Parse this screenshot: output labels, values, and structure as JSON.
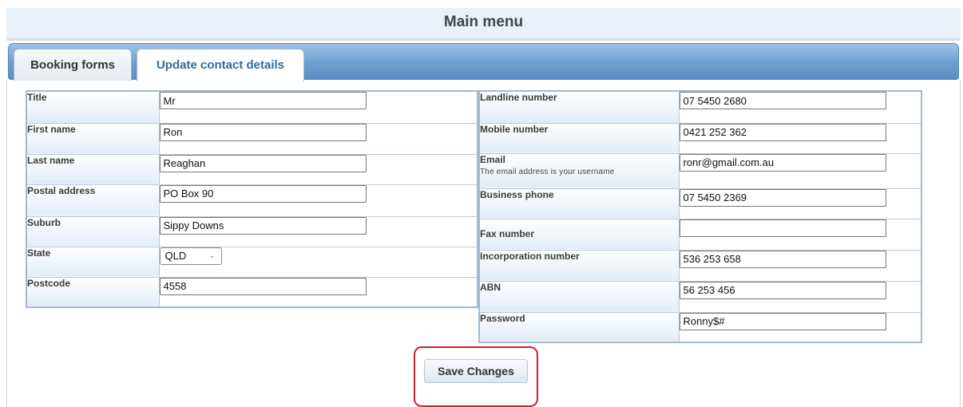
{
  "page": {
    "title": "Main menu"
  },
  "tabs": [
    {
      "label": "Booking forms",
      "active": false
    },
    {
      "label": "Update contact details",
      "active": true
    }
  ],
  "left_form": {
    "title": {
      "label": "Title",
      "value": "Mr"
    },
    "first_name": {
      "label": "First name",
      "value": "Ron"
    },
    "last_name": {
      "label": "Last name",
      "value": "Reaghan"
    },
    "postal_address": {
      "label": "Postal address",
      "value": "PO Box 90"
    },
    "suburb": {
      "label": "Suburb",
      "value": "Sippy Downs"
    },
    "state": {
      "label": "State",
      "value": "QLD"
    },
    "postcode": {
      "label": "Postcode",
      "value": "4558"
    }
  },
  "right_form": {
    "landline": {
      "label": "Landline number",
      "value": "07 5450 2680"
    },
    "mobile": {
      "label": "Mobile number",
      "value": "0421 252 362"
    },
    "email": {
      "label": "Email",
      "note": "The email address is your username",
      "value": "ronr@gmail.com.au"
    },
    "business_phone": {
      "label": "Business phone",
      "value": "07 5450 2369"
    },
    "fax": {
      "label": "Fax number",
      "value": ""
    },
    "incorporation": {
      "label": "Incorporation number",
      "value": "536 253 658"
    },
    "abn": {
      "label": "ABN",
      "value": "56 253 456"
    },
    "password": {
      "label": "Password",
      "value": "Ronny$#"
    }
  },
  "actions": {
    "save_label": "Save Changes"
  },
  "colors": {
    "tab_active_text": "#2d6ca2",
    "tabbar": "#6fa0d0",
    "highlight": "#d61e2b"
  },
  "icons": {
    "state_dropdown": "chevron-down-icon"
  }
}
